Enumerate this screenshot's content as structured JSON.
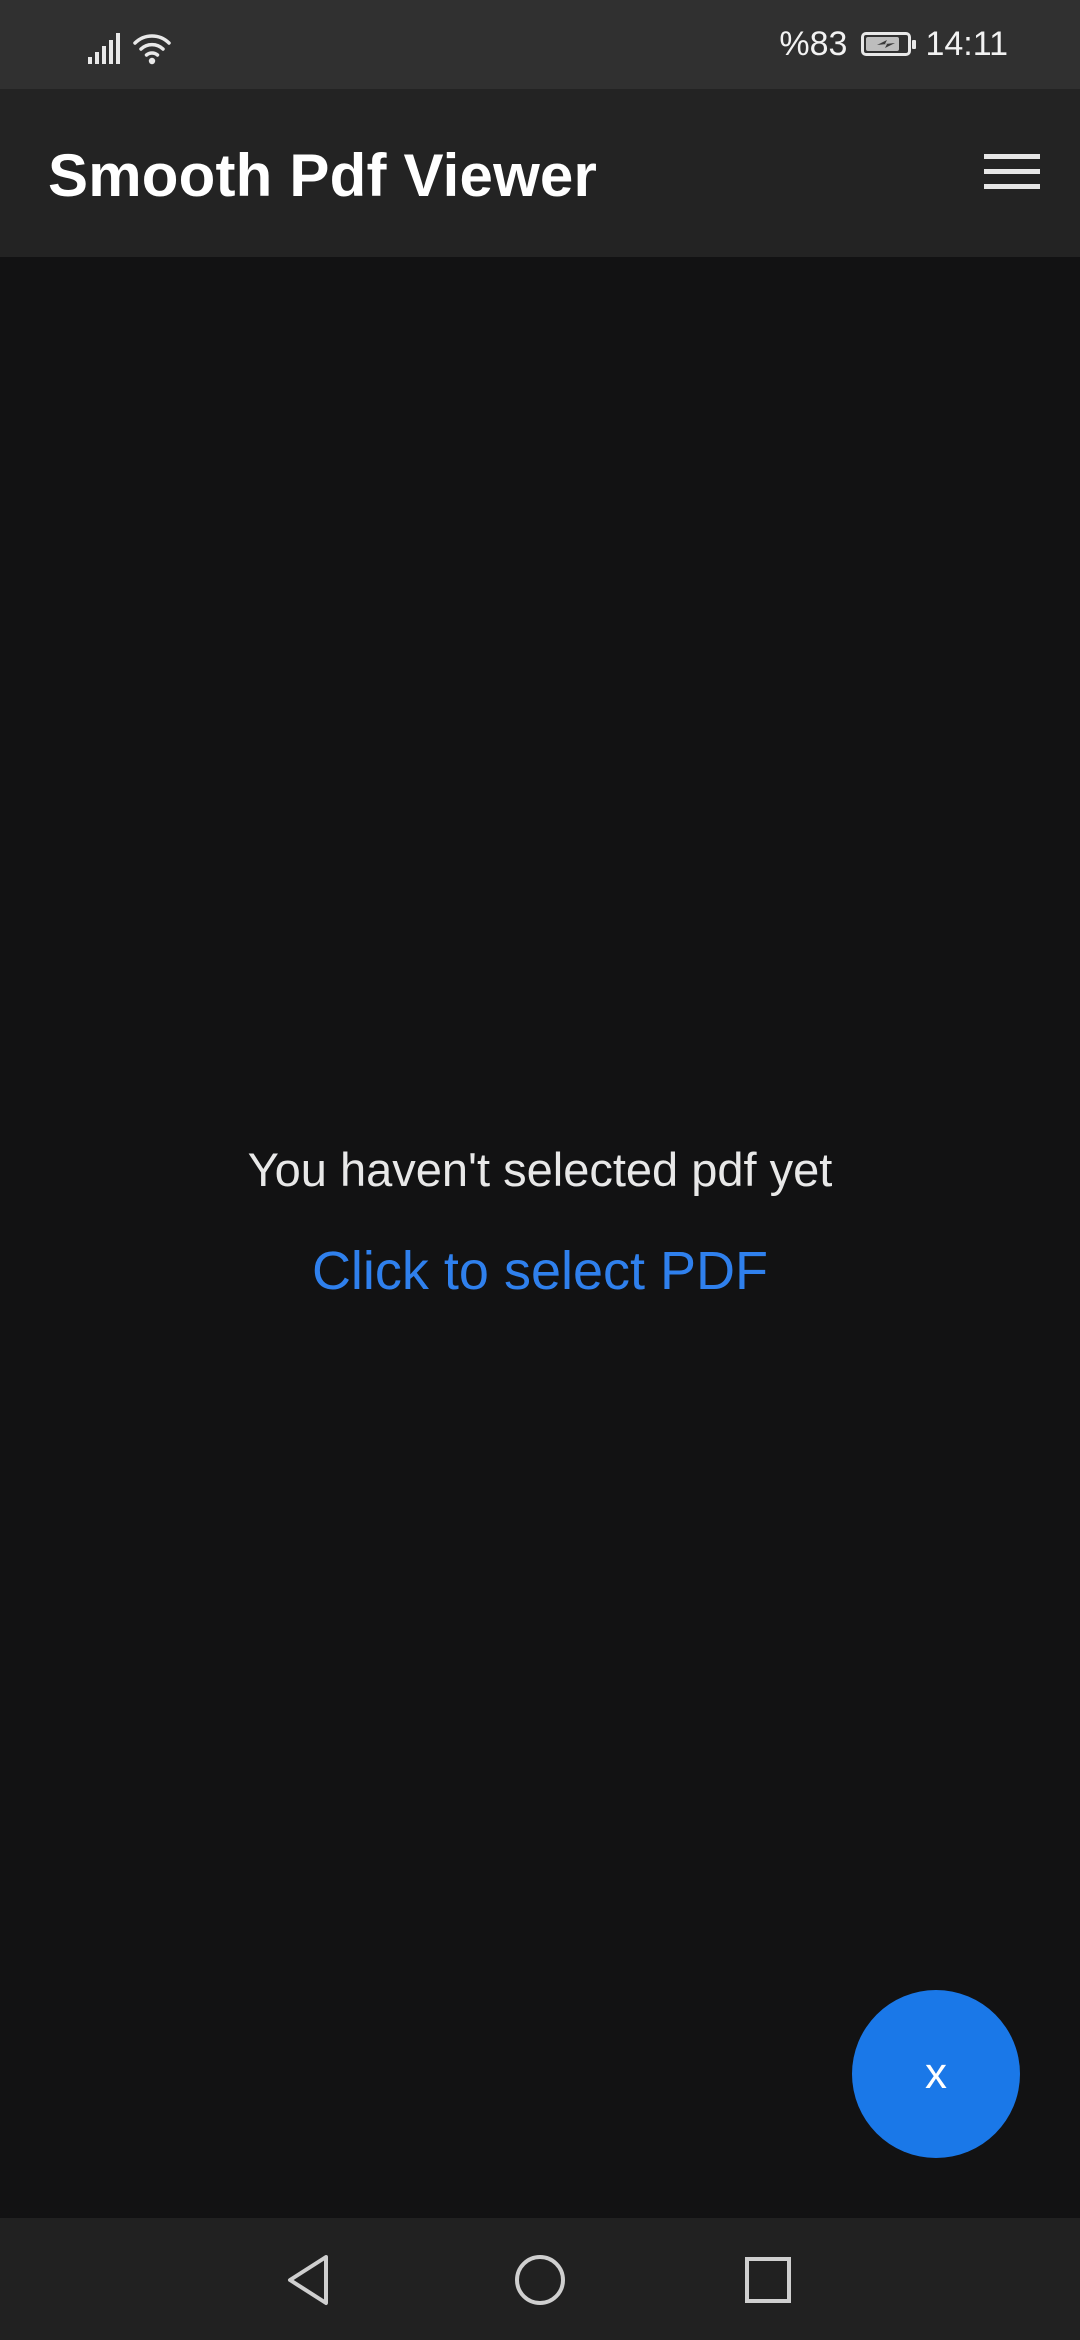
{
  "status_bar": {
    "battery_text": "%83",
    "battery_level": 0.83,
    "time": "14:11",
    "icons": [
      "signal-icon",
      "wifi-icon",
      "battery-charging-icon"
    ]
  },
  "app_bar": {
    "title": "Smooth Pdf Viewer",
    "menu_icon": "hamburger-menu-icon"
  },
  "content": {
    "empty_message": "You haven't selected pdf yet",
    "select_link": "Click to select PDF"
  },
  "fab": {
    "label": "x"
  },
  "nav_bar": {
    "buttons": [
      "back-icon",
      "home-icon",
      "recents-icon"
    ]
  },
  "colors": {
    "background": "#121213",
    "status_bar": "#303030",
    "app_bar": "#232323",
    "nav_bar": "#212121",
    "accent": "#1a78e8",
    "link": "#2f80ed"
  }
}
